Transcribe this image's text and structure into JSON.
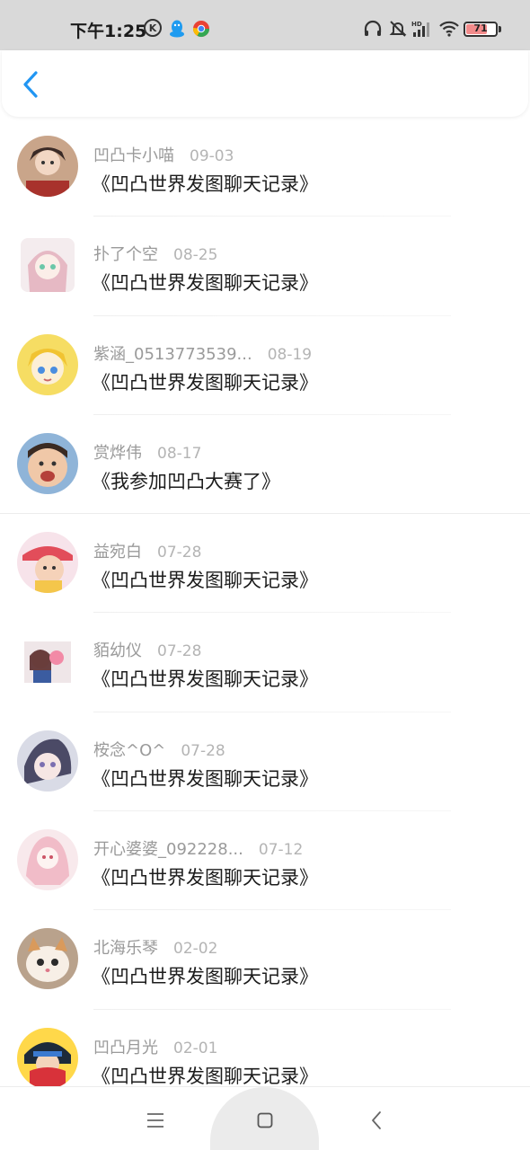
{
  "status_bar": {
    "time": "下午1:25",
    "battery": "71",
    "battery_level": 0.71,
    "icons": [
      "k-circle-icon",
      "qq-icon",
      "chrome-icon",
      "headset-icon",
      "bell-muted-icon",
      "hd-signal-icon",
      "wifi-icon",
      "battery-icon"
    ]
  },
  "header": {
    "back_icon": "chevron-left-icon",
    "accent_color": "#2196f3"
  },
  "items": [
    {
      "name": "凹凸卡小喵",
      "date": "09-03",
      "title": "《凹凸世界发图聊天记录》"
    },
    {
      "name": "扑了个空",
      "date": "08-25",
      "title": "《凹凸世界发图聊天记录》"
    },
    {
      "name": "紫涵_0513773539...",
      "date": "08-19",
      "title": "《凹凸世界发图聊天记录》"
    },
    {
      "name": "赏烨伟",
      "date": "08-17",
      "title": "《我参加凹凸大赛了》"
    },
    {
      "name": "益宛白",
      "date": "07-28",
      "title": "《凹凸世界发图聊天记录》"
    },
    {
      "name": "貊幼仪",
      "date": "07-28",
      "title": "《凹凸世界发图聊天记录》"
    },
    {
      "name": "桉念^O^",
      "date": "07-28",
      "title": "《凹凸世界发图聊天记录》"
    },
    {
      "name": "开心婆婆_092228...",
      "date": "07-12",
      "title": "《凹凸世界发图聊天记录》"
    },
    {
      "name": "北海乐琴",
      "date": "02-02",
      "title": "《凹凸世界发图聊天记录》"
    },
    {
      "name": "凹凸月光",
      "date": "02-01",
      "title": "《凹凸世界发图聊天记录》"
    }
  ],
  "nav_bar": {
    "icons": [
      "menu-icon",
      "home-square-icon",
      "back-chevron-icon"
    ]
  }
}
